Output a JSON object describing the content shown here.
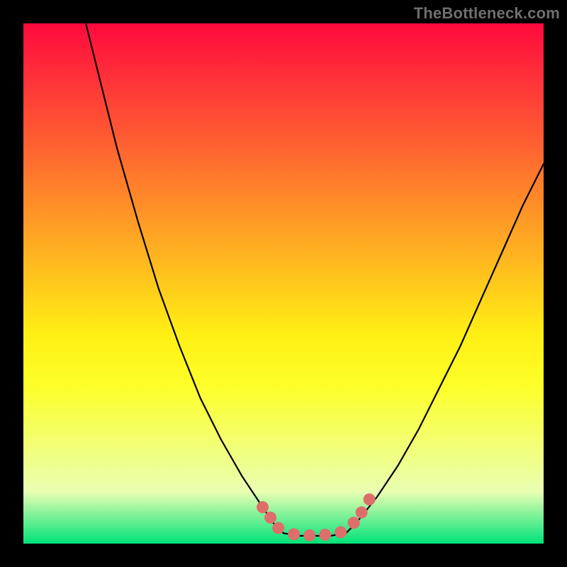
{
  "watermark": "TheBottleneck.com",
  "chart_data": {
    "type": "line",
    "title": "",
    "xlabel": "",
    "ylabel": "",
    "xlim": [
      0,
      100
    ],
    "ylim": [
      0,
      100
    ],
    "grid": false,
    "legend": false,
    "notes": "Axes are unlabeled; values are percentage estimates from pixel positions. Y=100 at top, Y=0 at bottom. Two monotone curves descending/ascending from a flat minimum near x≈49-62, y≈1-2.",
    "series": [
      {
        "name": "left-branch",
        "x": [
          12,
          15,
          18,
          22,
          26,
          30,
          34,
          38,
          42,
          46,
          48,
          50
        ],
        "y": [
          100,
          88,
          76,
          62,
          49,
          38,
          28,
          20,
          13,
          7,
          4,
          2
        ]
      },
      {
        "name": "right-branch",
        "x": [
          62,
          64,
          68,
          72,
          76,
          80,
          84,
          88,
          92,
          96,
          100
        ],
        "y": [
          2,
          4,
          9,
          15,
          22,
          30,
          38,
          47,
          56,
          65,
          73
        ]
      },
      {
        "name": "flat-minimum",
        "x": [
          50,
          53,
          56,
          59,
          62
        ],
        "y": [
          2,
          1.5,
          1.5,
          1.5,
          2
        ]
      }
    ],
    "markers": {
      "name": "highlight-dots",
      "color": "#de6e6a",
      "points": [
        {
          "x": 46,
          "y": 7
        },
        {
          "x": 47.5,
          "y": 5
        },
        {
          "x": 49,
          "y": 3
        },
        {
          "x": 52,
          "y": 1.8
        },
        {
          "x": 55,
          "y": 1.6
        },
        {
          "x": 58,
          "y": 1.7
        },
        {
          "x": 61,
          "y": 2.2
        },
        {
          "x": 63.5,
          "y": 4
        },
        {
          "x": 65,
          "y": 6
        },
        {
          "x": 66.5,
          "y": 8.5
        }
      ]
    },
    "background_gradient_stops": [
      {
        "pos": 0,
        "color": "#ff0a3c"
      },
      {
        "pos": 50,
        "color": "#ffc91c"
      },
      {
        "pos": 90,
        "color": "#e9ffb2"
      },
      {
        "pos": 100,
        "color": "#00e27a"
      }
    ]
  }
}
